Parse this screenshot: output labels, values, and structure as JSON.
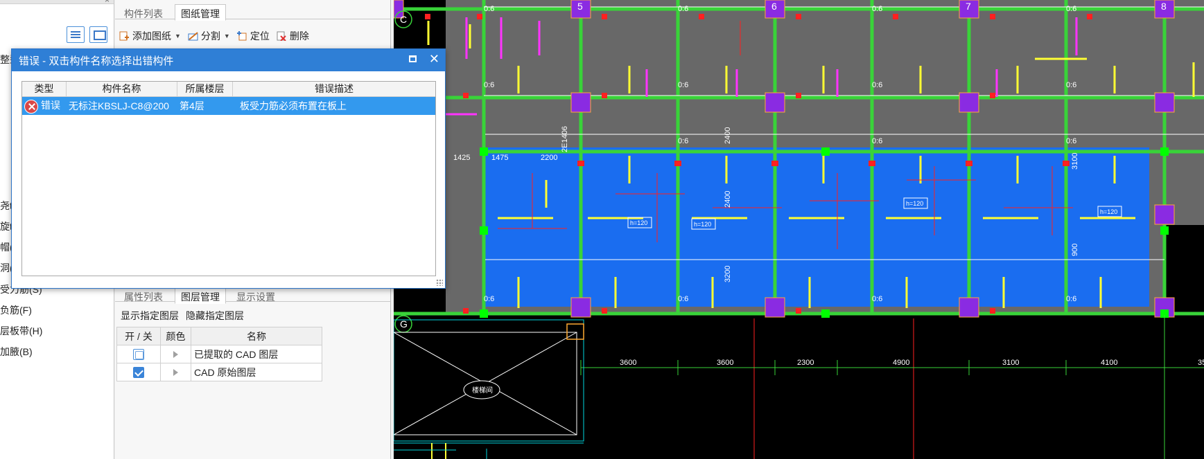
{
  "left_panel": {
    "tree_items": [
      "尧t",
      "旋t",
      "帽(",
      "洞(",
      "受力筋(S)",
      "负筋(F)",
      "层板带(H)",
      "加腋(B)"
    ],
    "partial_label": "整型"
  },
  "mid_panel": {
    "top_tabs": [
      "构件列表",
      "图纸管理"
    ],
    "toolbar": {
      "add_drawing": "添加图纸",
      "split": "分割",
      "locate": "定位",
      "delete": "删除"
    },
    "bottom_tabs": [
      "属性列表",
      "图层管理",
      "显示设置"
    ],
    "layer_actions": {
      "show": "显示指定图层",
      "hide": "隐藏指定图层"
    },
    "layer_table": {
      "headers": [
        "开 / 关",
        "颜色",
        "名称"
      ],
      "rows": [
        {
          "checked": false,
          "name": "已提取的 CAD 图层"
        },
        {
          "checked": true,
          "name": "CAD 原始图层"
        }
      ]
    }
  },
  "error_dialog": {
    "title": "错误 - 双击构件名称选择出错构件",
    "columns": [
      "类型",
      "构件名称",
      "所属楼层",
      "错误描述"
    ],
    "rows": [
      {
        "type": "错误",
        "name": "无标注KBSLJ-C8@200",
        "floor": "第4层",
        "desc": "板受力筋必须布置在板上"
      }
    ]
  },
  "cad": {
    "labels": {
      "axis_top": [
        "5",
        "6",
        "7",
        "8"
      ],
      "axis_c": "C",
      "axis_g": "G",
      "rebar_code": "0:6",
      "dims_left": [
        "1425",
        "1475",
        "2200"
      ],
      "dims_vert": [
        "2400",
        "2400",
        "3200",
        "3100",
        "900",
        "2E1406"
      ],
      "slab_tags": [
        "h=120",
        "h=120",
        "h=120",
        "h=120"
      ],
      "bottom_dims": [
        "3600",
        "3600",
        "2300",
        "4900",
        "3100",
        "4100",
        "35"
      ],
      "well_label": "楼梯间"
    },
    "colors": {
      "slab": "#1a6df0",
      "grey": "#686868",
      "green": "#39d339",
      "yellow": "#ffff33",
      "magenta": "#ff33ff",
      "red": "#ff2020",
      "purple": "#8a2be2",
      "cyan": "#00d8e0"
    }
  }
}
